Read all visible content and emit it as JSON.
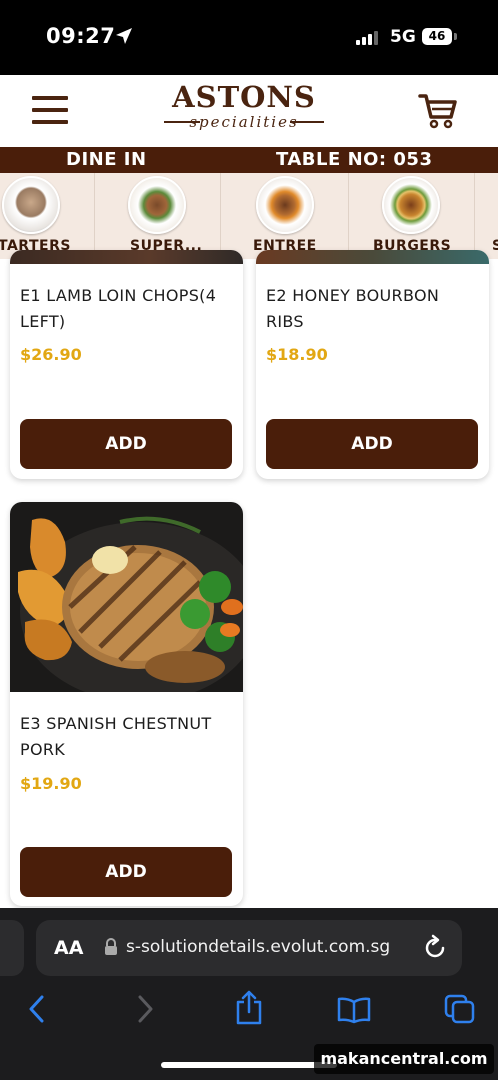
{
  "status_bar": {
    "time": "09:27",
    "network": "5G",
    "battery": "46"
  },
  "header": {
    "brand": "ASTONS",
    "brand_sub": "specialities"
  },
  "order_bar": {
    "mode": "DINE IN",
    "table": "TABLE NO: 053"
  },
  "categories": [
    {
      "label": "STARTERS",
      "visible_label": "TARTERS"
    },
    {
      "label": "SUPER..."
    },
    {
      "label": "ENTREE"
    },
    {
      "label": "BURGERS"
    },
    {
      "label": "S"
    }
  ],
  "items": [
    {
      "name": "E1 LAMB LOIN CHOPS(4 LEFT)",
      "price": "$26.90",
      "button": "ADD"
    },
    {
      "name": "E2 HONEY BOURBON RIBS",
      "price": "$18.90",
      "button": "ADD"
    },
    {
      "name": "E3 SPANISH CHESTNUT PORK",
      "price": "$19.90",
      "button": "ADD"
    }
  ],
  "browser": {
    "text_size": "AA",
    "url": "s-solutiondetails.evolut.com.sg"
  },
  "watermark": "makancentral.com",
  "colors": {
    "brand_brown": "#4a1e0a",
    "price_gold": "#e2a713",
    "category_bg": "#f4e9e1"
  }
}
